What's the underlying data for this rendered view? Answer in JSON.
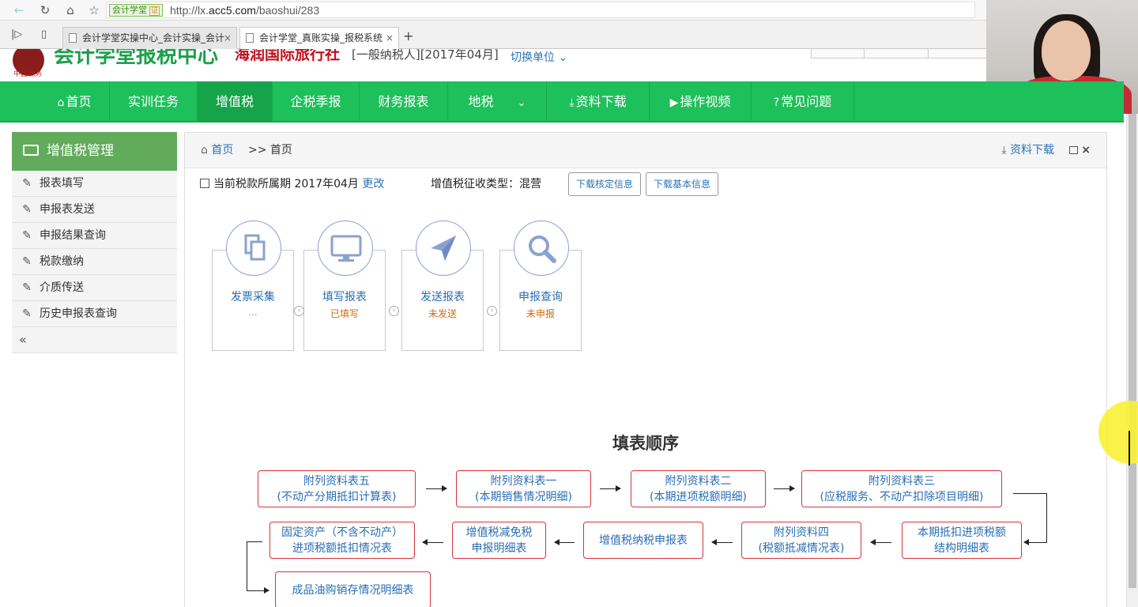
{
  "browser": {
    "secure_label": "会计学堂",
    "cert_label": "证",
    "url_prefix": "http://lx.",
    "url_host": "acc5.com",
    "url_path": "/baoshui/283",
    "tabs": [
      {
        "label": "会计学堂实操中心_会计实操_会计"
      },
      {
        "label": "会计学堂_真账实操_报税系统"
      }
    ],
    "new_tab": "+"
  },
  "header": {
    "logo_sub": "中国税务",
    "site_title": "会计学堂报税中心",
    "company": "海润国际旅行社",
    "company_meta": "[一般纳税人][2017年04月]",
    "switch_unit": "切换单位"
  },
  "nav": {
    "items": [
      {
        "label": "首页",
        "icon": "home-icon"
      },
      {
        "label": "实训任务"
      },
      {
        "label": "增值税",
        "active": true
      },
      {
        "label": "企税季报"
      },
      {
        "label": "财务报表"
      },
      {
        "label": "地税",
        "icon": "chevron-down-icon"
      },
      {
        "label": "资料下载",
        "icon": "download-icon"
      },
      {
        "label": "操作视频",
        "icon": "play-circle-icon"
      },
      {
        "label": "常见问题",
        "icon": "question-circle-icon"
      }
    ],
    "colors": {
      "bg": "#1dc05a",
      "active": "#16a44b"
    }
  },
  "sidebar": {
    "title": "增值税管理",
    "items": [
      {
        "label": "报表填写"
      },
      {
        "label": "申报表发送"
      },
      {
        "label": "申报结果查询"
      },
      {
        "label": "税款缴纳"
      },
      {
        "label": "介质传送"
      },
      {
        "label": "历史申报表查询"
      }
    ],
    "collapse": "«"
  },
  "breadcrumb": {
    "home": "首页",
    "current": ">> 首页",
    "download": "资料下载"
  },
  "info": {
    "period_label": "当前税款所属期 2017年04月",
    "period_change": "更改",
    "tax_type": "增值税征收类型：混营",
    "btn_verify": "下载核定信息",
    "btn_basic": "下载基本信息"
  },
  "steps": [
    {
      "title": "发票采集",
      "status": "...",
      "icon": "documents-icon"
    },
    {
      "title": "填写报表",
      "status": "已填写",
      "icon": "monitor-icon"
    },
    {
      "title": "发送报表",
      "status": "未发送",
      "icon": "paper-plane-icon"
    },
    {
      "title": "申报查询",
      "status": "未申报",
      "icon": "search-icon"
    }
  ],
  "fill_order": {
    "title": "填表顺序",
    "boxes": [
      {
        "l1": "附列资料表五",
        "l2": "(不动产分期抵扣计算表)"
      },
      {
        "l1": "附列资料表一",
        "l2": "(本期销售情况明细)"
      },
      {
        "l1": "附列资料表二",
        "l2": "(本期进项税额明细)"
      },
      {
        "l1": "附列资料表三",
        "l2": "(应税服务、不动产扣除项目明细)"
      },
      {
        "l1": "本期抵扣进项税额",
        "l2": "结构明细表"
      },
      {
        "l1": "附列资料四",
        "l2": "(税额抵减情况表)"
      },
      {
        "l1": "增值税纳税申报表",
        "l2": ""
      },
      {
        "l1": "增值税减免税",
        "l2": "申报明细表"
      },
      {
        "l1": "固定资产（不含不动产）",
        "l2": "进项税额抵扣情况表"
      },
      {
        "l1": "成品油购销存情况明细表",
        "l2": ""
      }
    ]
  }
}
